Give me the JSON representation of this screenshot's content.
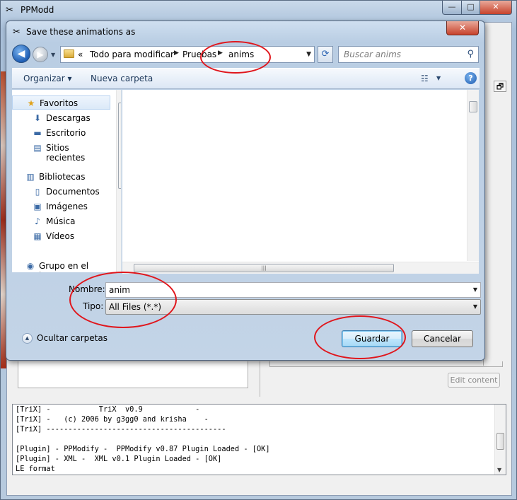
{
  "parent_window": {
    "title": "PPModd",
    "icon": "tools-icon",
    "controls": {
      "minimize": "—",
      "maximize": "□",
      "close": "✕",
      "restore": "🗗"
    },
    "edit_content_label": "Edit content",
    "console_lines": [
      "[TriX] -           TriX  v0.9            -",
      "[TriX] -   (c) 2006 by g3gg0 and krisha    -",
      "[TriX] -----------------------------------------",
      "",
      "[Plugin] - PPModify -  PPModify v0.87 Plugin Loaded - [OK]",
      "[Plugin] - XML -  XML v0.1 Plugin Loaded - [OK]",
      "LE format"
    ]
  },
  "dialog": {
    "title": "Save these animations as",
    "icon": "tools-icon",
    "close_label": "✕",
    "address": {
      "overflow": "«",
      "crumbs": [
        "Todo para modificar",
        "Pruebas",
        "anims"
      ]
    },
    "search_placeholder": "Buscar anims",
    "toolbar": {
      "organize": "Organizar ▾",
      "new_folder": "Nueva carpeta",
      "help": "?"
    },
    "nav_items": [
      {
        "label": "Favoritos",
        "icon": "★",
        "icon_name": "star-icon",
        "level": 0,
        "selected": true
      },
      {
        "label": "Descargas",
        "icon": "⬇",
        "icon_name": "downloads-icon",
        "level": 1
      },
      {
        "label": "Escritorio",
        "icon": "▬",
        "icon_name": "desktop-icon",
        "level": 1
      },
      {
        "label": "Sitios recientes",
        "icon": "▤",
        "icon_name": "recent-places-icon",
        "level": 1
      },
      {
        "label": "Bibliotecas",
        "icon": "▥",
        "icon_name": "libraries-icon",
        "level": 0
      },
      {
        "label": "Documentos",
        "icon": "▯",
        "icon_name": "documents-icon",
        "level": 1
      },
      {
        "label": "Imágenes",
        "icon": "▣",
        "icon_name": "pictures-icon",
        "level": 1
      },
      {
        "label": "Música",
        "icon": "♪",
        "icon_name": "music-icon",
        "level": 1
      },
      {
        "label": "Vídeos",
        "icon": "▦",
        "icon_name": "videos-icon",
        "level": 1
      },
      {
        "label": "Grupo en el hogar",
        "icon": "◉",
        "icon_name": "homegroup-icon",
        "level": 0
      }
    ],
    "name_label": "Nombre:",
    "name_value": "anim",
    "type_label": "Tipo:",
    "type_value": "All Files (*.*)",
    "hide_folders": "Ocultar carpetas",
    "save_button": "Guardar",
    "cancel_button": "Cancelar"
  },
  "colors": {
    "annotation_red": "#e0161c",
    "title_bar": "#b9cde3",
    "accent_blue": "#1f5fb5"
  }
}
